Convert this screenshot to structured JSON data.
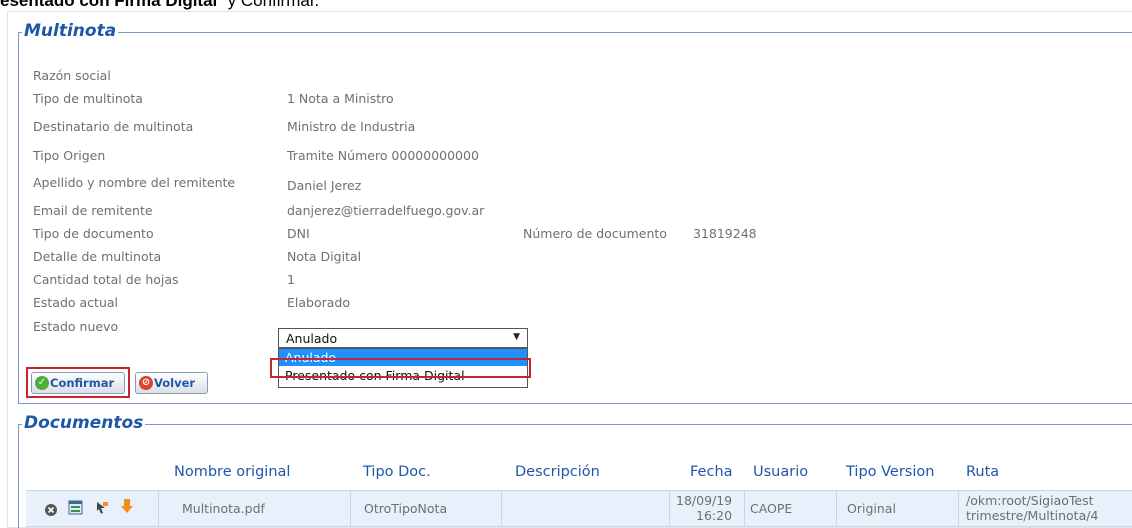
{
  "caption": {
    "bold_text": "esentado con Firma Digital",
    "tail_text": "” y Confirmar."
  },
  "multinota": {
    "legend": "Multinota",
    "fields": [
      {
        "label": "Razón social",
        "value": ""
      },
      {
        "label": "Tipo de multinota",
        "value": "1 Nota a Ministro"
      },
      {
        "label": "Destinatario de multinota",
        "value": "Ministro de Industria"
      },
      {
        "label": "Tipo Origen",
        "value": "Tramite Número 00000000000"
      },
      {
        "label": "Apellido y nombre del remitente",
        "value": "Daniel Jerez"
      },
      {
        "label": "Email de remitente",
        "value": "danjerez@tierradelfuego.gov.ar"
      },
      {
        "label": "Tipo de documento",
        "value": "DNI"
      },
      {
        "label": "Detalle de multinota",
        "value": "Nota Digital"
      },
      {
        "label": "Cantidad total de hojas",
        "value": "1"
      },
      {
        "label": "Estado actual",
        "value": "Elaborado"
      },
      {
        "label": "Estado nuevo",
        "value": ""
      }
    ],
    "numero_documento": {
      "label": "Número de documento",
      "value": "31819248"
    },
    "estado_nuevo_select": {
      "selected": "Anulado",
      "options": [
        "Anulado",
        "Presentado con Firma Digital"
      ]
    },
    "buttons": {
      "confirmar": "Confirmar",
      "volver": "Volver"
    }
  },
  "documentos": {
    "legend": "Documentos",
    "columns": [
      "Nombre original",
      "Tipo Doc.",
      "Descripción",
      "Fecha",
      "Usuario",
      "Tipo Version",
      "Ruta"
    ],
    "rows": [
      {
        "nombre": "Multinota.pdf",
        "tipo_doc": "OtroTipoNota",
        "descripcion": "",
        "fecha_date": "18/09/19",
        "fecha_time": "16:20",
        "usuario": "CAOPE",
        "tipo_version": "Original",
        "ruta_line1": "/okm:root/SigiaoTest",
        "ruta_line2": "trimestre/Multinota/4"
      }
    ],
    "row_icons": [
      "delete-icon",
      "window-icon",
      "move-icon",
      "download-icon"
    ]
  },
  "colors": {
    "accent": "#1f57a8",
    "highlight": "#c1272d",
    "selected_option": "#1e90ff",
    "row_bg": "#e7f0fb"
  }
}
